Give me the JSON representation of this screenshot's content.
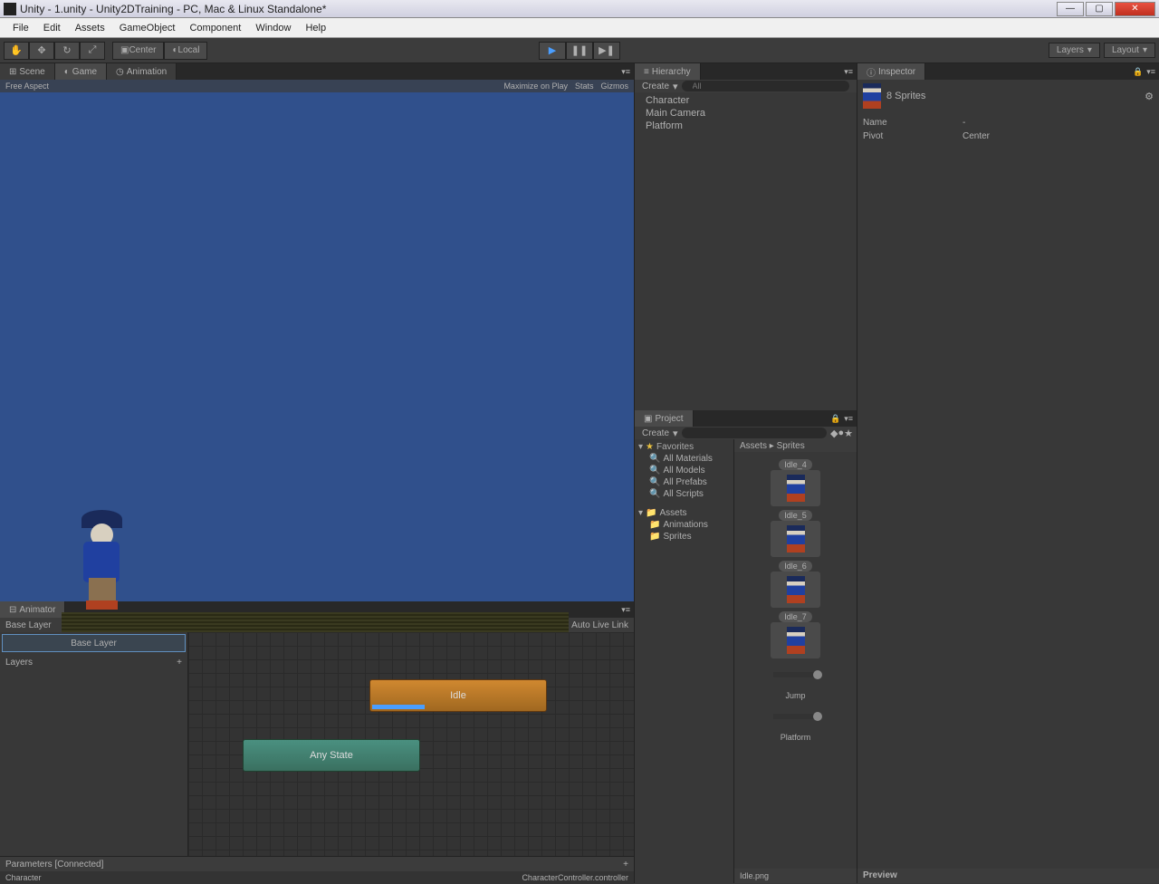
{
  "window": {
    "title": "Unity - 1.unity - Unity2DTraining - PC, Mac & Linux Standalone*"
  },
  "menubar": [
    "File",
    "Edit",
    "Assets",
    "GameObject",
    "Component",
    "Window",
    "Help"
  ],
  "toolbar": {
    "center": "Center",
    "local": "Local",
    "layers": "Layers",
    "layout": "Layout"
  },
  "tabs": {
    "scene": "Scene",
    "game": "Game",
    "animation": "Animation",
    "hierarchy": "Hierarchy",
    "project": "Project",
    "inspector": "Inspector",
    "animator": "Animator"
  },
  "game_view": {
    "aspect": "Free Aspect",
    "maximize": "Maximize on Play",
    "stats": "Stats",
    "gizmos": "Gizmos"
  },
  "hierarchy": {
    "create": "Create",
    "search_hint": "All",
    "items": [
      "Character",
      "Main Camera",
      "Platform"
    ]
  },
  "project": {
    "create": "Create",
    "favorites": "Favorites",
    "fav_items": [
      "All Materials",
      "All Models",
      "All Prefabs",
      "All Scripts"
    ],
    "assets": "Assets",
    "folders": [
      "Animations",
      "Sprites"
    ],
    "breadcrumb": "Assets ▸ Sprites",
    "grid": [
      {
        "label": "Idle_4",
        "type": "sprite"
      },
      {
        "label": "Idle_5",
        "type": "sprite"
      },
      {
        "label": "Idle_6",
        "type": "sprite"
      },
      {
        "label": "Idle_7",
        "type": "sprite"
      },
      {
        "label": "Jump",
        "type": "anim"
      },
      {
        "label": "Platform",
        "type": "anim"
      }
    ],
    "footer": "Idle.png"
  },
  "inspector": {
    "title": "8 Sprites",
    "props": {
      "name_label": "Name",
      "name_value": "-",
      "pivot_label": "Pivot",
      "pivot_value": "Center"
    },
    "preview": "Preview"
  },
  "animator": {
    "breadcrumb": "Base Layer",
    "auto_live": "Auto Live Link",
    "base_layer": "Base Layer",
    "layers": "Layers",
    "parameters": "Parameters [Connected]",
    "state_idle": "Idle",
    "state_any": "Any State",
    "status_left": "Character",
    "status_right": "CharacterController.controller"
  }
}
